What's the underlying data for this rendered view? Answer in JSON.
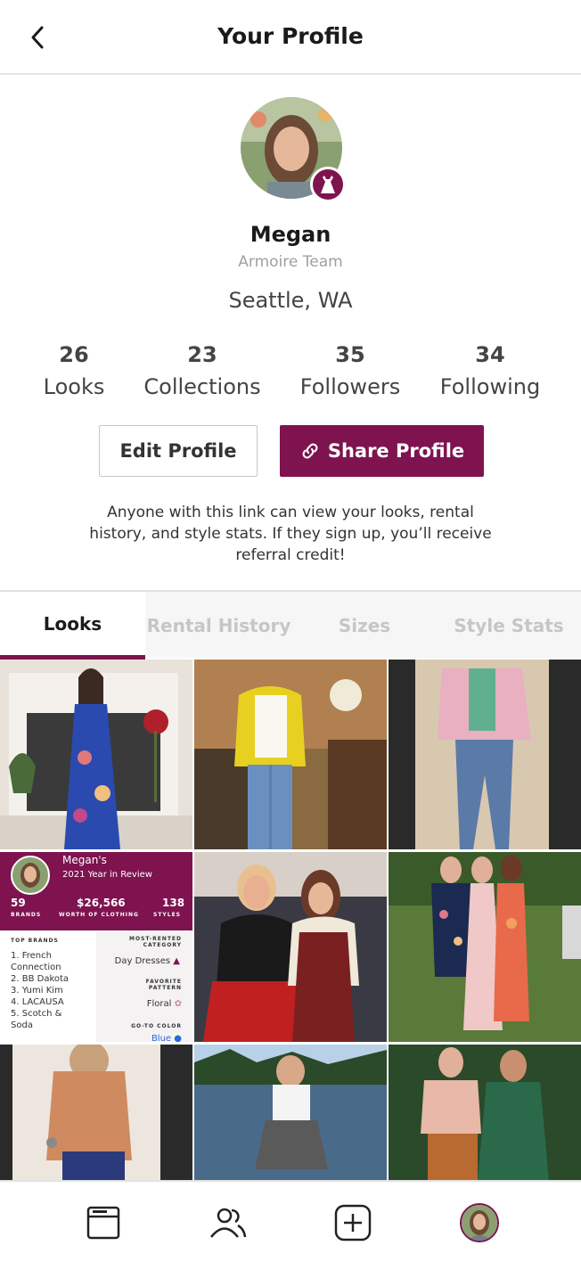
{
  "header": {
    "title": "Your Profile",
    "back_icon": "chevron-left-icon"
  },
  "profile": {
    "name": "Megan",
    "team": "Armoire Team",
    "location": "Seattle, WA",
    "badge_icon": "dress-icon"
  },
  "stats": [
    {
      "value": "26",
      "label": "Looks"
    },
    {
      "value": "23",
      "label": "Collections"
    },
    {
      "value": "35",
      "label": "Followers"
    },
    {
      "value": "34",
      "label": "Following"
    }
  ],
  "actions": {
    "edit_label": "Edit Profile",
    "share_label": "Share Profile",
    "share_icon": "link-icon"
  },
  "info_text": "Anyone with this link can view your looks, rental history, and style stats. If they sign up, you’ll receive referral credit!",
  "tabs": [
    {
      "label": "Looks",
      "active": true
    },
    {
      "label": "Rental History",
      "active": false
    },
    {
      "label": "Sizes",
      "active": false
    },
    {
      "label": "Style Stats",
      "active": false
    }
  ],
  "year_in_review": {
    "title_line1": "Megan's",
    "title_line2": "2021 Year in Review",
    "stat1_value": "59",
    "stat1_label": "BRANDS",
    "stat2_value": "$26,566",
    "stat2_label": "WORTH OF CLOTHING",
    "stat3_value": "138",
    "stat3_label": "STYLES",
    "brands_heading": "TOP BRANDS",
    "brands": [
      "1. French",
      "Connection",
      "2. BB Dakota",
      "3. Yumi Kim",
      "4. LACAUSA",
      "5. Scotch &",
      "Soda"
    ],
    "category_heading_1": "MOST-RENTED",
    "category_heading_2": "CATEGORY",
    "category_value": "Day Dresses",
    "pattern_heading_1": "FAVORITE",
    "pattern_heading_2": "PATTERN",
    "pattern_value": "Floral",
    "color_heading": "GO-TO COLOR",
    "color_value": "Blue"
  },
  "colors": {
    "accent": "#7e1350"
  },
  "bottom_nav": [
    "browse-icon",
    "community-icon",
    "add-look-icon",
    "profile-avatar"
  ]
}
